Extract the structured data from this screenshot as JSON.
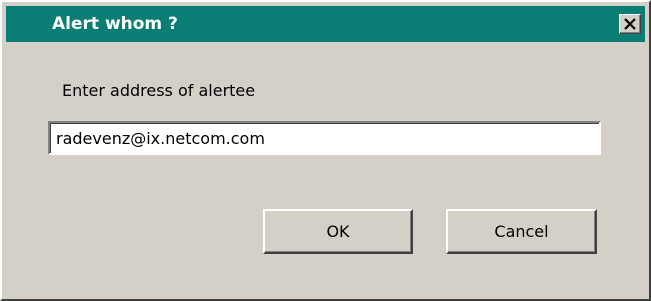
{
  "window": {
    "title": "Alert whom ?",
    "titlebar_color": "#0a7e74",
    "background_color": "#d4d0c8",
    "close_icon": "close-x-icon"
  },
  "form": {
    "prompt_label": "Enter address of alertee",
    "address_value": "radevenz@ix.netcom.com"
  },
  "buttons": {
    "ok_label": "OK",
    "cancel_label": "Cancel"
  }
}
